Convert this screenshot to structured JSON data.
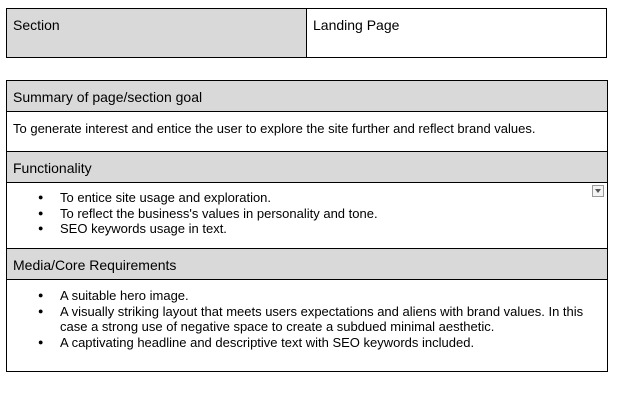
{
  "header_table": {
    "label": "Section",
    "value": "Landing Page"
  },
  "summary": {
    "heading": "Summary of page/section goal",
    "text": "To generate interest and entice the user to explore the site further and reflect brand values."
  },
  "functionality": {
    "heading": "Functionality",
    "items": [
      "To entice site usage and exploration.",
      "To reflect the business's values in personality and tone.",
      "SEO keywords usage in text."
    ]
  },
  "media": {
    "heading": "Media/Core Requirements",
    "items": [
      "A suitable hero image.",
      "A visually striking layout that meets users expectations and aliens with brand values. In this case a strong use of negative space to create a subdued minimal aesthetic.",
      "A captivating headline and descriptive text with SEO keywords included."
    ]
  }
}
